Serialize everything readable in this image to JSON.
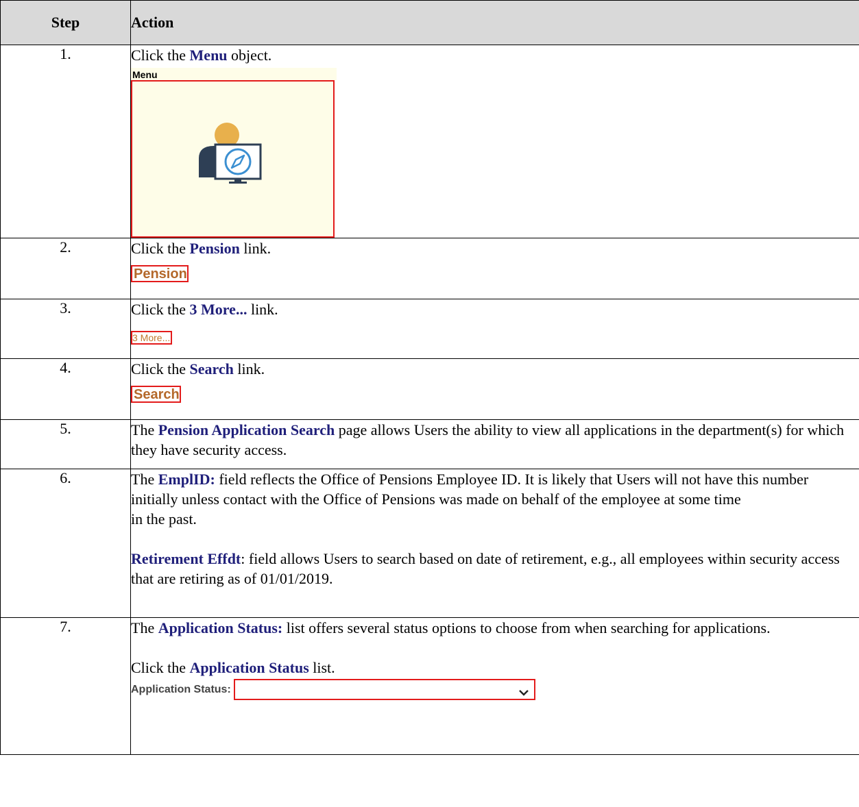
{
  "header": {
    "step": "Step",
    "action": "Action"
  },
  "steps": [
    {
      "num": "1.",
      "pre": "Click the ",
      "kw": "Menu",
      "post": " object.",
      "tile_label": "Menu"
    },
    {
      "num": "2.",
      "pre": "Click the ",
      "kw": "Pension",
      "post": " link.",
      "capture": "Pension"
    },
    {
      "num": "3.",
      "pre": "Click the ",
      "kw": "3 More...",
      "post": " link.",
      "capture": "3 More..."
    },
    {
      "num": "4.",
      "pre": "Click the ",
      "kw": "Search",
      "post": " link.",
      "capture": "Search"
    },
    {
      "num": "5.",
      "pre": "The ",
      "kw": "Pension Application Search",
      "post": " page allows Users the ability to view all applications in the department(s) for which they have security access."
    },
    {
      "num": "6.",
      "pre": "The ",
      "kw": "EmplID:",
      "post": " field reflects the Office of Pensions Employee ID.  It is likely that Users will not have this number initially unless contact with the Office of Pensions was made on behalf of the employee at some time",
      "line2": "in the past.",
      "kw2": "Retirement Effdt",
      "post2": ": field allows Users to search based on date of retirement, e.g., all employees within security access that are retiring as of 01/01/2019."
    },
    {
      "num": "7.",
      "pre": "The ",
      "kw": "Application Status:",
      "post": " list offers several status options to choose from when searching for applications.",
      "pre2": "Click the ",
      "kw2": "Application Status",
      "post2": " list.",
      "field_label": "Application Status:"
    }
  ]
}
